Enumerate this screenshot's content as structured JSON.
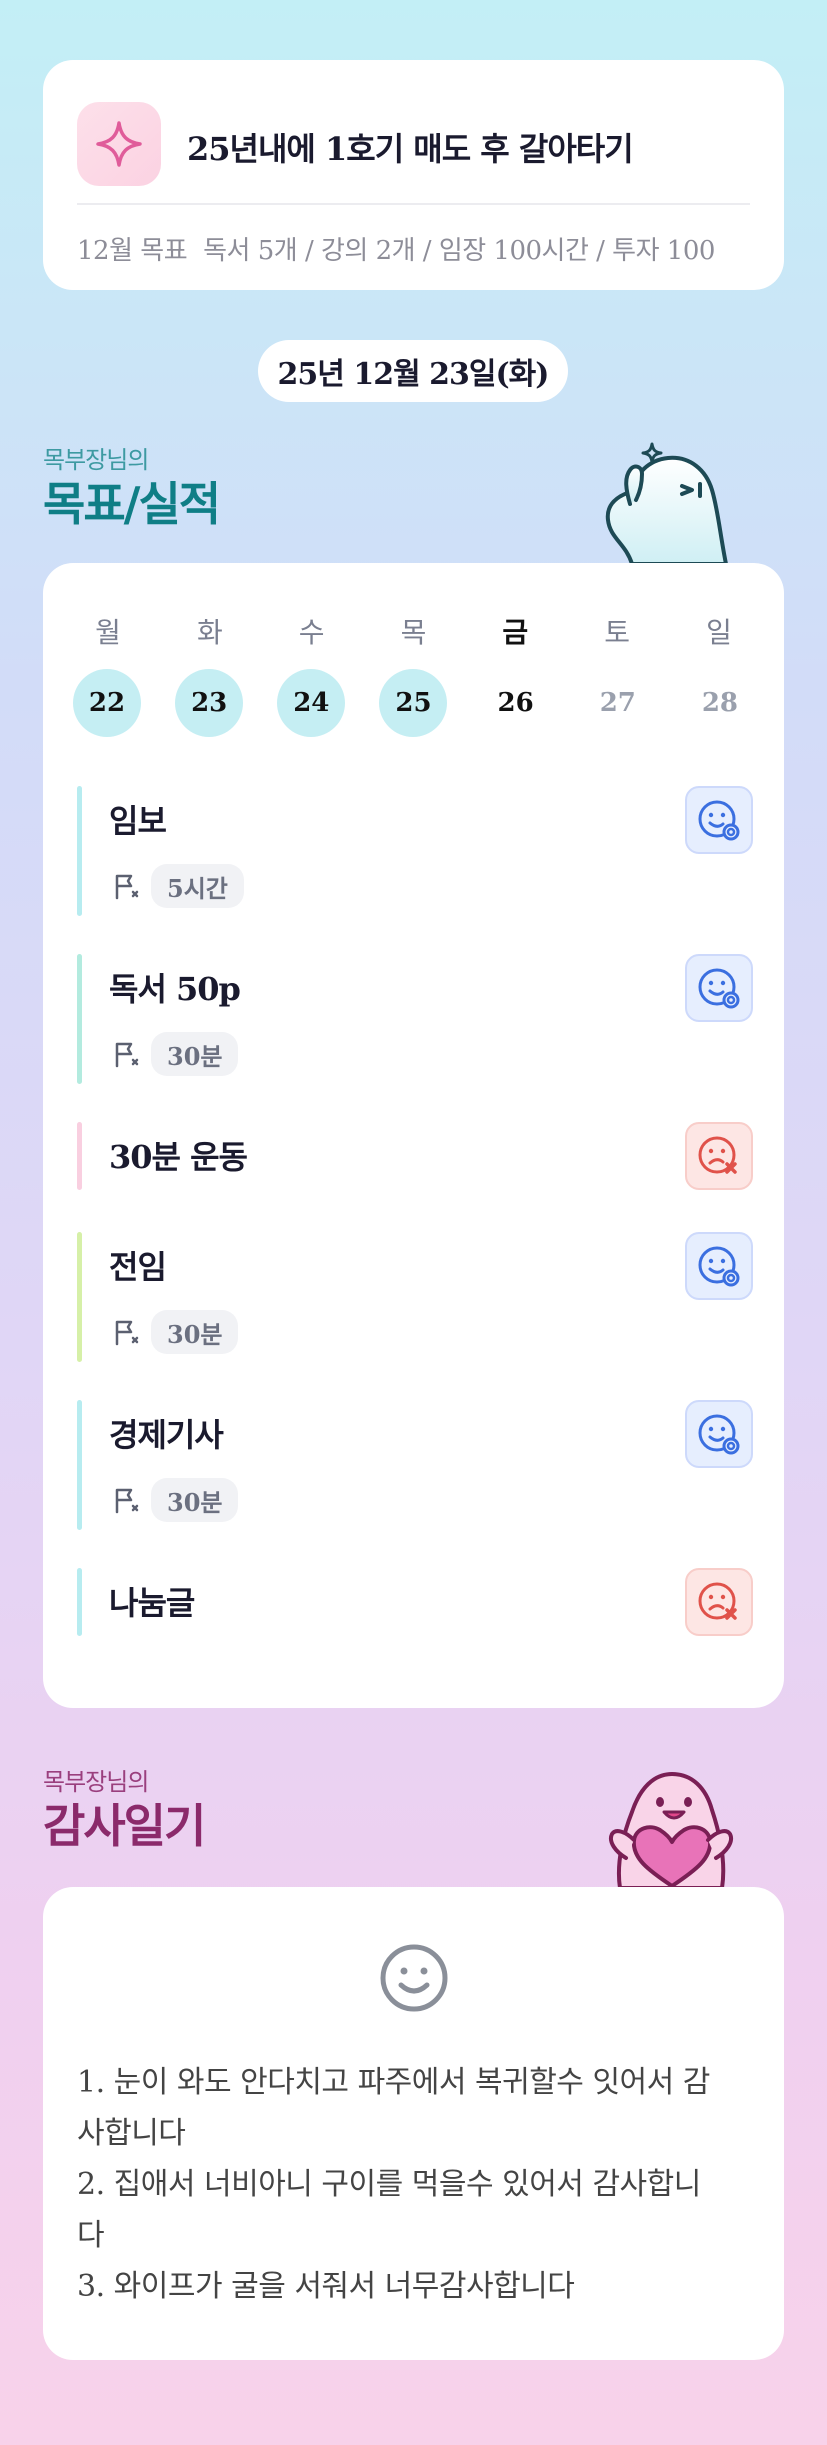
{
  "goal": {
    "title": "25년내에 1호기 매도 후 갈아타기",
    "month_label": "12월 목표",
    "month_goals": "독서 5개 / 강의 2개 / 임장 100시간 / 투자 100",
    "icon": "sparkle-icon"
  },
  "date": "25년 12월 23일(화)",
  "goals_section": {
    "subtitle": "목부장님의",
    "title": "목표/실적"
  },
  "week": {
    "labels": [
      "월",
      "화",
      "수",
      "목",
      "금",
      "토",
      "일"
    ],
    "days": [
      "22",
      "23",
      "24",
      "25",
      "26",
      "27",
      "28"
    ]
  },
  "tasks": [
    {
      "name": "임보",
      "time": "5시간",
      "status": "success",
      "bar_color": "#b7ecf0"
    },
    {
      "name": "독서 50p",
      "time": "30분",
      "status": "success",
      "bar_color": "#b3ebdf"
    },
    {
      "name": "30분 운동",
      "time": "",
      "status": "fail",
      "bar_color": "#f9cfe0"
    },
    {
      "name": "전임",
      "time": "30분",
      "status": "success",
      "bar_color": "#d6f0a8"
    },
    {
      "name": "경제기사",
      "time": "30분",
      "status": "success",
      "bar_color": "#b7ecf0"
    },
    {
      "name": "나눔글",
      "time": "",
      "status": "fail",
      "bar_color": "#b7ecf0"
    }
  ],
  "gratitude_section": {
    "subtitle": "목부장님의",
    "title": "감사일기"
  },
  "gratitude": {
    "icon": "smile-icon",
    "lines": [
      "1. 눈이 와도 안다치고 파주에서 복귀할수 잇어서 감",
      "사합니다",
      "2. 집애서 너비아니 구이를 먹을수 있어서 감사합니",
      "다",
      "3. 와이프가 굴을 서줘서 너무감사합니다"
    ]
  },
  "colors": {
    "accent_teal": "#0f7e86",
    "accent_plum": "#8b2a6b",
    "success_blue": "#3b6fe0",
    "fail_red": "#e0524a"
  }
}
